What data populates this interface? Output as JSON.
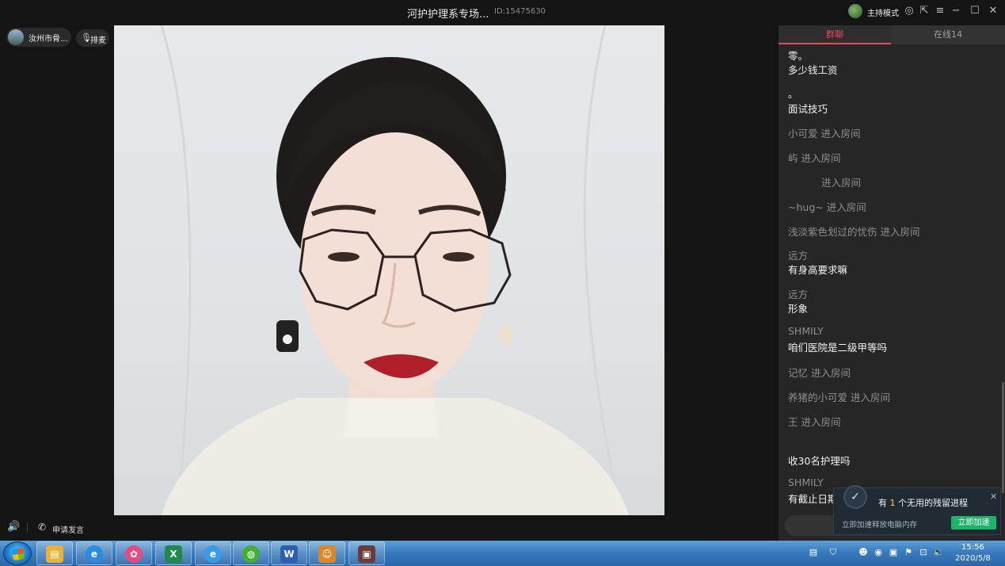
{
  "window": {
    "title": "河护护理系专场...",
    "room_id": "ID:15475630",
    "host_mode": "主持模式"
  },
  "left": {
    "user_name": "汝州市骨...",
    "mic_label": "排麦",
    "apply_speak": "申请发言"
  },
  "chat": {
    "tabs": {
      "chat": "群聊",
      "online": "在线14"
    },
    "messages": [
      {
        "kind": "text",
        "text": "零。"
      },
      {
        "kind": "text",
        "text": "多少钱工资"
      },
      {
        "kind": "text",
        "text": "。"
      },
      {
        "kind": "text",
        "text": "面试技巧"
      },
      {
        "kind": "sys",
        "text": "小可爱 进入房间"
      },
      {
        "kind": "sys",
        "text": "屿 进入房间"
      },
      {
        "kind": "sys",
        "text": "进入房间"
      },
      {
        "kind": "sys",
        "text": "~hug~ 进入房间"
      },
      {
        "kind": "sys",
        "text": "浅淡紫色划过的忧伤 进入房间"
      },
      {
        "kind": "nick",
        "text": "远方"
      },
      {
        "kind": "text",
        "text": "有身高要求嘛"
      },
      {
        "kind": "nick",
        "text": "远方"
      },
      {
        "kind": "text",
        "text": "形象"
      },
      {
        "kind": "nick",
        "text": "SHMILY"
      },
      {
        "kind": "text",
        "text": "咱们医院是二级甲等吗"
      },
      {
        "kind": "sys",
        "text": "记忆 进入房间"
      },
      {
        "kind": "sys",
        "text": "养猪的小可爱 进入房间"
      },
      {
        "kind": "sys",
        "text": "王 进入房间"
      },
      {
        "kind": "text",
        "text": "收30名护理吗"
      },
      {
        "kind": "nick",
        "text": "SHMILY"
      },
      {
        "kind": "text",
        "text": "有截止日期"
      }
    ]
  },
  "popup": {
    "title_pre": "有",
    "title_count": "1",
    "title_post": "个无用的残留进程",
    "subtitle": "立即加速释放电脑内存",
    "button": "立即加速"
  },
  "taskbar": {
    "apps": [
      {
        "name": "file-explorer",
        "glyph": "▤",
        "color": "#e6b43c"
      },
      {
        "name": "browser-360",
        "glyph": "e",
        "color": "#2b8be0"
      },
      {
        "name": "pinwheel",
        "glyph": "✿",
        "color": "#e84a7f"
      },
      {
        "name": "excel",
        "glyph": "X",
        "color": "#1f8a4c"
      },
      {
        "name": "internet-explorer",
        "glyph": "e",
        "color": "#3a9be8"
      },
      {
        "name": "wechat",
        "glyph": "◍",
        "color": "#41b035"
      },
      {
        "name": "word",
        "glyph": "W",
        "color": "#2b5fb4"
      },
      {
        "name": "game-app",
        "glyph": "☺",
        "color": "#d9892a"
      },
      {
        "name": "live-app",
        "glyph": "▣",
        "color": "#6b3a3a"
      }
    ],
    "time": "15:56",
    "date": "2020/5/8"
  }
}
